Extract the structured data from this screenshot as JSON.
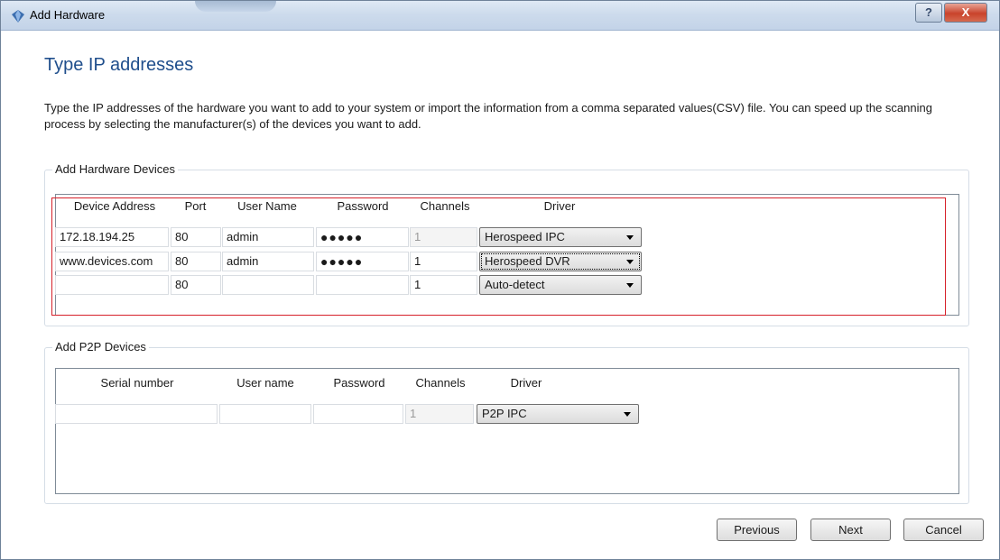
{
  "window": {
    "title": "Add Hardware",
    "help_symbol": "?",
    "close_symbol": "X"
  },
  "page": {
    "heading": "Type IP addresses",
    "description": "Type the IP addresses of the hardware you want to add to your system or import the information from a comma separated values(CSV) file. You can speed up the scanning process by selecting the manufacturer(s) of the devices you want to add."
  },
  "hardware": {
    "group_label": "Add Hardware Devices",
    "columns": [
      "Device Address",
      "Port",
      "User Name",
      "Password",
      "Channels",
      "Driver"
    ],
    "rows": [
      {
        "address": "172.18.194.25",
        "port": "80",
        "user": "admin",
        "password": "●●●●●",
        "channels": "1",
        "driver": "Herospeed IPC"
      },
      {
        "address": "www.devices.com",
        "port": "80",
        "user": "admin",
        "password": "●●●●●",
        "channels": "1",
        "driver": "Herospeed DVR"
      },
      {
        "address": "",
        "port": "80",
        "user": "",
        "password": "",
        "channels": "1",
        "driver": "Auto-detect"
      }
    ]
  },
  "p2p": {
    "group_label": "Add P2P Devices",
    "columns": [
      "Serial number",
      "User name",
      "Password",
      "Channels",
      "Driver"
    ],
    "rows": [
      {
        "serial": "",
        "user": "",
        "password": "",
        "channels": "1",
        "driver": "P2P IPC"
      }
    ]
  },
  "buttons": {
    "previous": "Previous",
    "next": "Next",
    "cancel": "Cancel"
  },
  "colors": {
    "heading": "#1f4e8c",
    "highlight_box": "#d6202a",
    "close_button": "#c9432b"
  }
}
